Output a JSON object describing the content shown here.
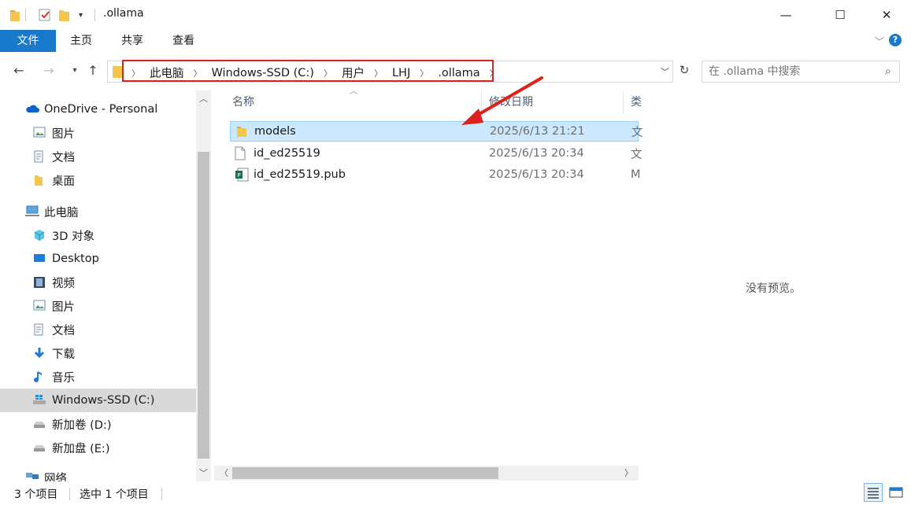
{
  "window": {
    "title": ".ollama",
    "minimize": "—",
    "maximize": "☐",
    "close": "✕"
  },
  "ribbon": {
    "tabs": [
      "文件",
      "主页",
      "共享",
      "查看"
    ]
  },
  "address": {
    "crumbs": [
      "此电脑",
      "Windows-SSD (C:)",
      "用户",
      "LHJ",
      ".ollama"
    ]
  },
  "search": {
    "placeholder": "在 .ollama 中搜索"
  },
  "nav": {
    "items": [
      {
        "label": "OneDrive - Personal",
        "icon": "onedrive-cloud-icon"
      },
      {
        "label": "图片",
        "icon": "pictures-icon"
      },
      {
        "label": "文档",
        "icon": "documents-icon"
      },
      {
        "label": "桌面",
        "icon": "folder-icon"
      },
      {
        "label": "此电脑",
        "icon": "this-pc-icon"
      },
      {
        "label": "3D 对象",
        "icon": "3d-objects-icon"
      },
      {
        "label": "Desktop",
        "icon": "desktop-icon"
      },
      {
        "label": "视频",
        "icon": "videos-icon"
      },
      {
        "label": "图片",
        "icon": "pictures-icon"
      },
      {
        "label": "文档",
        "icon": "documents-icon"
      },
      {
        "label": "下载",
        "icon": "downloads-icon"
      },
      {
        "label": "音乐",
        "icon": "music-icon"
      },
      {
        "label": "Windows-SSD (C:)",
        "icon": "windows-drive-icon"
      },
      {
        "label": "新加卷 (D:)",
        "icon": "drive-icon"
      },
      {
        "label": "新加盘 (E:)",
        "icon": "drive-icon"
      },
      {
        "label": "网络",
        "icon": "network-icon"
      }
    ]
  },
  "columns": {
    "name": "名称",
    "modified": "修改日期",
    "type": "类"
  },
  "files": [
    {
      "name": "models",
      "modified": "2025/6/13 21:21",
      "type": "文",
      "icon": "folder-icon"
    },
    {
      "name": "id_ed25519",
      "modified": "2025/6/13 20:34",
      "type": "文",
      "icon": "file-icon"
    },
    {
      "name": "id_ed25519.pub",
      "modified": "2025/6/13 20:34",
      "type": "M",
      "icon": "publisher-file-icon"
    }
  ],
  "preview": {
    "text": "没有预览。"
  },
  "status": {
    "count": "3 个项目",
    "selected": "选中 1 个项目"
  },
  "colors": {
    "accent": "#1979ca",
    "selection": "#cce8ff",
    "annotation": "#e0201b",
    "folder": "#f5c64e"
  }
}
